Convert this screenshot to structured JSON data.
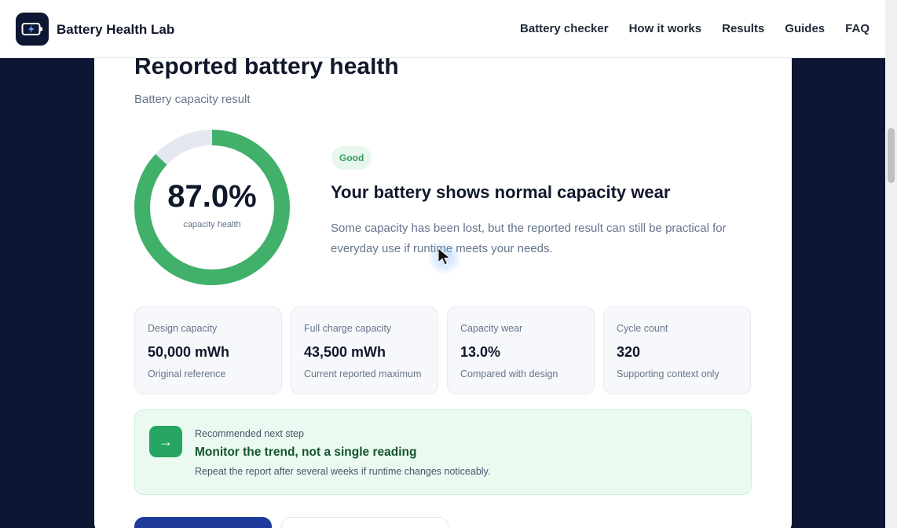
{
  "header": {
    "brand": "Battery Health Lab",
    "logo_icon": "battery-bolt-icon",
    "nav": [
      {
        "label": "Battery checker"
      },
      {
        "label": "How it works"
      },
      {
        "label": "Results"
      },
      {
        "label": "Guides"
      },
      {
        "label": "FAQ"
      }
    ]
  },
  "result": {
    "title": "Reported battery health",
    "subtitle": "Battery capacity result",
    "health_value": "87.0%",
    "health_fraction": 0.87,
    "health_label": "capacity health",
    "badge": "Good",
    "headline": "Your battery shows normal capacity wear",
    "description": "Some capacity has been lost, but the reported result can still be practical for everyday use if runtime meets your needs."
  },
  "stats": [
    {
      "label": "Design capacity",
      "value": "50,000 mWh",
      "note": "Original reference"
    },
    {
      "label": "Full charge capacity",
      "value": "43,500 mWh",
      "note": "Current reported maximum"
    },
    {
      "label": "Capacity wear",
      "value": "13.0%",
      "note": "Compared with design"
    },
    {
      "label": "Cycle count",
      "value": "320",
      "note": "Supporting context only"
    }
  ],
  "recommendation": {
    "kicker": "Recommended next step",
    "title": "Monitor the trend, not a single reading",
    "text": "Repeat the report after several weeks if runtime changes noticeably.",
    "icon": "arrow-right-icon"
  },
  "colors": {
    "ring_fill": "#41b06a",
    "ring_track": "#e5e8f0",
    "navy": "#0d1733",
    "primary_button": "#1e3a9a"
  }
}
